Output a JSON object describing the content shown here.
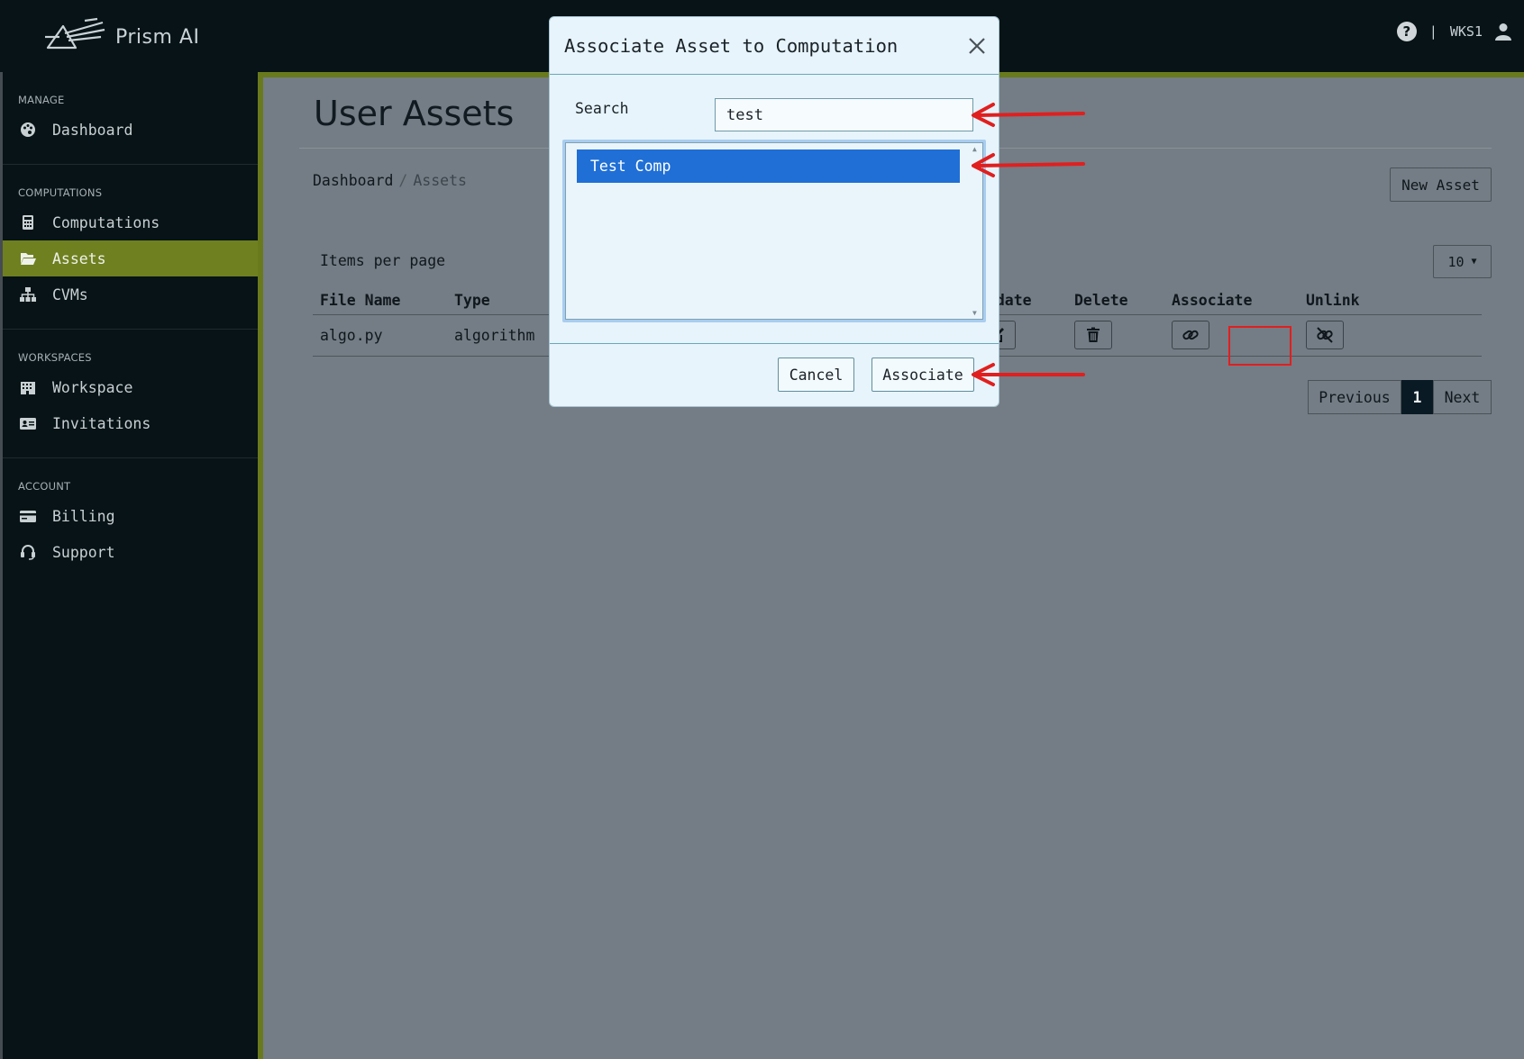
{
  "app": {
    "name": "Prism AI",
    "workspace": "WKS1",
    "separator": "|"
  },
  "icons": {
    "logo": "prism-logo-icon",
    "help": "question-circle-icon",
    "user": "user-icon"
  },
  "colors": {
    "accent": "#6f8020",
    "selected_option": "#1f6fd6",
    "annotation": "#e01f1f"
  },
  "sidebar": {
    "sections": [
      {
        "heading": "MANAGE",
        "items": [
          {
            "label": "Dashboard",
            "icon": "palette-icon"
          }
        ]
      },
      {
        "heading": "COMPUTATIONS",
        "items": [
          {
            "label": "Computations",
            "icon": "calculator-icon"
          },
          {
            "label": "Assets",
            "icon": "folder-open-icon",
            "active": true
          },
          {
            "label": "CVMs",
            "icon": "sitemap-icon"
          }
        ]
      },
      {
        "heading": "WORKSPACES",
        "items": [
          {
            "label": "Workspace",
            "icon": "building-icon"
          },
          {
            "label": "Invitations",
            "icon": "id-card-icon"
          }
        ]
      },
      {
        "heading": "ACCOUNT",
        "items": [
          {
            "label": "Billing",
            "icon": "credit-card-icon"
          },
          {
            "label": "Support",
            "icon": "headset-icon"
          }
        ]
      }
    ]
  },
  "main": {
    "title": "User Assets",
    "breadcrumb": {
      "root": "Dashboard",
      "separator": "/",
      "current": "Assets"
    },
    "new_asset_label": "New Asset",
    "items_per_page_label": "Items per page",
    "items_per_page_value": "10",
    "table": {
      "headers": {
        "file_name": "File Name",
        "type": "Type",
        "update": "Update",
        "delete": "Delete",
        "associate": "Associate",
        "unlink": "Unlink"
      },
      "rows": [
        {
          "file_name": "algo.py",
          "type": "algorithm"
        }
      ]
    },
    "pagination": {
      "previous": "Previous",
      "current": "1",
      "next": "Next"
    }
  },
  "modal": {
    "title": "Associate Asset to Computation",
    "search_label": "Search",
    "search_value": "test",
    "options": [
      {
        "label": "Test Comp",
        "selected": true
      }
    ],
    "cancel_label": "Cancel",
    "associate_label": "Associate"
  }
}
